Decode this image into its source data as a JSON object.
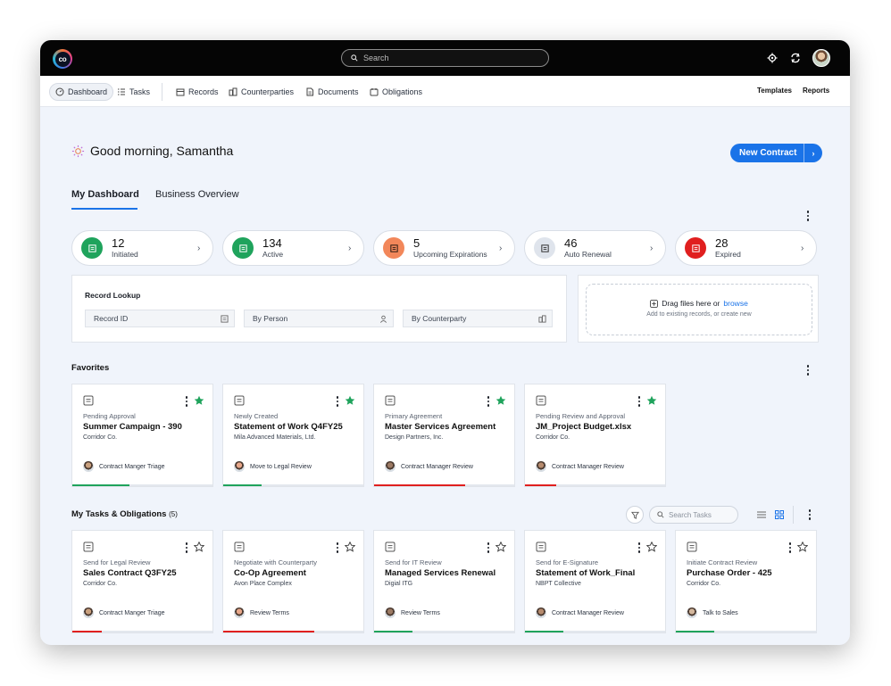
{
  "app": {
    "logo_text": "co"
  },
  "topbar": {
    "search_placeholder": "Search"
  },
  "nav": {
    "items": [
      {
        "label": "Dashboard",
        "icon": "dashboard-icon"
      },
      {
        "label": "Tasks",
        "icon": "tasks-icon"
      },
      {
        "label": "Records",
        "icon": "records-icon"
      },
      {
        "label": "Counterparties",
        "icon": "counterparties-icon"
      },
      {
        "label": "Documents",
        "icon": "documents-icon"
      },
      {
        "label": "Obligations",
        "icon": "obligations-icon"
      }
    ],
    "right": {
      "templates": "Templates",
      "reports": "Reports"
    }
  },
  "greeting": "Good morning, Samantha",
  "new_contract_label": "New Contract",
  "tabs": {
    "my_dashboard": "My Dashboard",
    "business_overview": "Business Overview"
  },
  "stats": [
    {
      "value": "12",
      "label": "Initiated",
      "color": "#1fa35c"
    },
    {
      "value": "134",
      "label": "Active",
      "color": "#1fa35c"
    },
    {
      "value": "5",
      "label": "Upcoming Expirations",
      "color": "#f2875a"
    },
    {
      "value": "46",
      "label": "Auto Renewal",
      "color": "#dfe4ec"
    },
    {
      "value": "28",
      "label": "Expired",
      "color": "#e01f1f"
    }
  ],
  "lookup": {
    "title": "Record Lookup",
    "fields": [
      "Record ID",
      "By Person",
      "By Counterparty"
    ]
  },
  "dropzone": {
    "text": "Drag files here or",
    "link": "browse",
    "subtext": "Add to existing records, or create new"
  },
  "favorites": {
    "title": "Favorites",
    "cards": [
      {
        "status": "Pending Approval",
        "title": "Summer Campaign - 390",
        "company": "Corridor Co.",
        "person": "Contract Manger Triage",
        "progress": 0.4,
        "color": "#1fa35c"
      },
      {
        "status": "Newly Created",
        "title": "Statement of Work Q4FY25",
        "company": "Mila Advanced Materials, Ltd.",
        "person": "Move to Legal Review",
        "progress": 0.27,
        "color": "#1fa35c"
      },
      {
        "status": "Primary Agreement",
        "title": "Master Services Agreement",
        "company": "Design Partners, Inc.",
        "person": "Contract Manager Review",
        "progress": 0.64,
        "color": "#e01f1f"
      },
      {
        "status": "Pending Review and Approval",
        "title": "JM_Project Budget.xlsx",
        "company": "Corridor Co.",
        "person": "Contract Manager Review",
        "progress": 0.22,
        "color": "#e01f1f"
      }
    ]
  },
  "tasks": {
    "title": "My Tasks & Obligations",
    "count": "(5)",
    "search_placeholder": "Search Tasks",
    "cards": [
      {
        "status": "Send for Legal Review",
        "title": "Sales Contract Q3FY25",
        "company": "Corridor Co.",
        "person": "Contract Manger Triage",
        "progress": 0.21,
        "color": "#e01f1f"
      },
      {
        "status": "Negotiate with Counterparty",
        "title": "Co-Op Agreement",
        "company": "Avon Place Complex",
        "person": "Review Terms",
        "progress": 0.64,
        "color": "#e01f1f"
      },
      {
        "status": "Send for IT Review",
        "title": "Managed Services Renewal",
        "company": "Digial ITG",
        "person": "Review Terms",
        "progress": 0.27,
        "color": "#1fa35c"
      },
      {
        "status": "Send for E-Signature",
        "title": "Statement of Work_Final",
        "company": "NBPT Collective",
        "person": "Contract Manager Review",
        "progress": 0.27,
        "color": "#1fa35c"
      },
      {
        "status": "Initiate Contract Review",
        "title": "Purchase Order - 425",
        "company": "Corridor Co.",
        "person": "Talk to Sales",
        "progress": 0.27,
        "color": "#1fa35c"
      }
    ]
  }
}
